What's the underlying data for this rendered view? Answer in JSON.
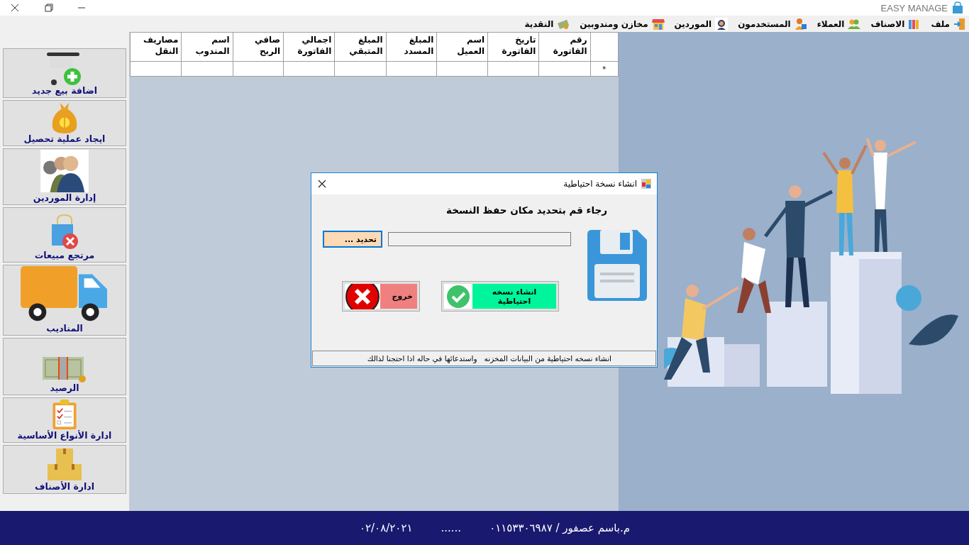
{
  "title_bar": {
    "title": "EASY MANAGE"
  },
  "menu": [
    {
      "label": "ملف",
      "kind": "door"
    },
    {
      "label": "الاصناف",
      "kind": "shelves"
    },
    {
      "label": "العملاء",
      "kind": "people"
    },
    {
      "label": "المستخدمون",
      "kind": "user-card"
    },
    {
      "label": "الموردين",
      "kind": "agent"
    },
    {
      "label": "مخازن ومندوبين",
      "kind": "store"
    },
    {
      "label": "النقدية",
      "kind": "cash"
    }
  ],
  "sidebar": {
    "items": [
      {
        "label": "اضافة بيع جديد",
        "kind": "cart-add"
      },
      {
        "label": "ايجاد عملية تحصيل",
        "kind": "money-bag"
      },
      {
        "label": "إدارة الموردين",
        "kind": "suppliers"
      },
      {
        "label": "مرتجع مبيعات",
        "kind": "bag-return"
      },
      {
        "label": "المناديب",
        "kind": "truck"
      },
      {
        "label": "الرصيد",
        "kind": "banknotes"
      },
      {
        "label": "ادارة الأنواع الأساسية",
        "kind": "clipboard"
      },
      {
        "label": "ادارة الأصناف",
        "kind": "boxes"
      }
    ]
  },
  "table": {
    "columns": [
      "رقم الفاتورة",
      "تاريخ الفاتورة",
      "اسم العميل",
      "المبلغ المسدد",
      "المبلغ المتبقي",
      "اجمالي الفاتورة",
      "صافي الربح",
      "اسم المندوب",
      "مصاريف النقل"
    ],
    "new_row_marker": "*"
  },
  "dialog": {
    "title": "انشاء نسخة احتياطية",
    "prompt": "رجاء قم بتحديد مكان حفظ النسخة",
    "browse_button": {
      "label": "تحديد ...",
      "focused": true
    },
    "buttons": [
      {
        "label": "انشاء نسخه احتياطية",
        "kind": "confirm"
      },
      {
        "label": "خروج",
        "kind": "exit"
      }
    ],
    "status": "انشاء نسخه احتياطية من البيانات المخزنه   واستدعائها في حاله اذا احتجنا لذالك"
  },
  "footer": {
    "developer": "م.باسم عصفور / ٠١١٥٣٣٠٦٩٨٧",
    "dots": "......",
    "date": "٠٢/٠٨/٢٠٢١"
  }
}
